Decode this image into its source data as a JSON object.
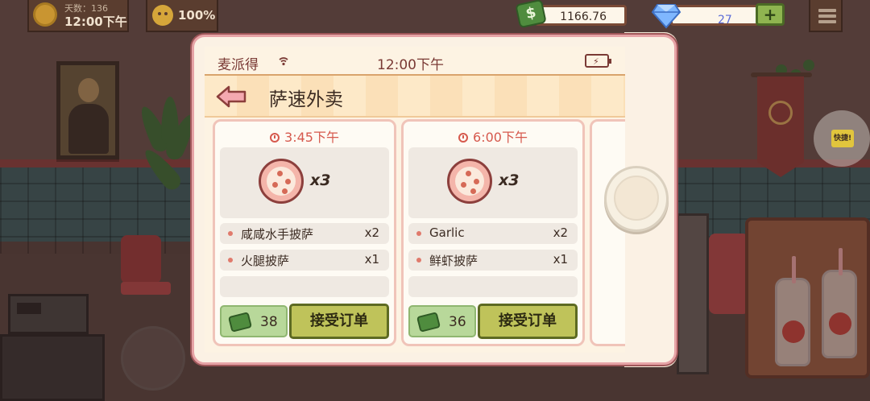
{
  "hud": {
    "day_label": "天数：136",
    "time": "12:00下午",
    "mood": "100%",
    "money": "1166.76",
    "gems": "27",
    "add_label": "+"
  },
  "quick_badge": "快捷!",
  "phone": {
    "carrier": "麦派得",
    "time": "12:00下午",
    "app_title": "萨速外卖"
  },
  "orders": [
    {
      "time": "3:45下午",
      "pizza_qty": "x3",
      "items": [
        {
          "name": "咸咸水手披萨",
          "qty": "x2"
        },
        {
          "name": "火腿披萨",
          "qty": "x1"
        }
      ],
      "price": "38",
      "accept_label": "接受订单"
    },
    {
      "time": "6:00下午",
      "pizza_qty": "x3",
      "items": [
        {
          "name": "Garlic",
          "qty": "x2"
        },
        {
          "name": "鲜虾披萨",
          "qty": "x1"
        }
      ],
      "price": "36",
      "accept_label": "接受订单"
    }
  ],
  "colors": {
    "accent": "#d6594d",
    "accept_button": "#bfc35a",
    "price_box": "#b8d89a",
    "phone_frame": "#e6a3a6"
  }
}
